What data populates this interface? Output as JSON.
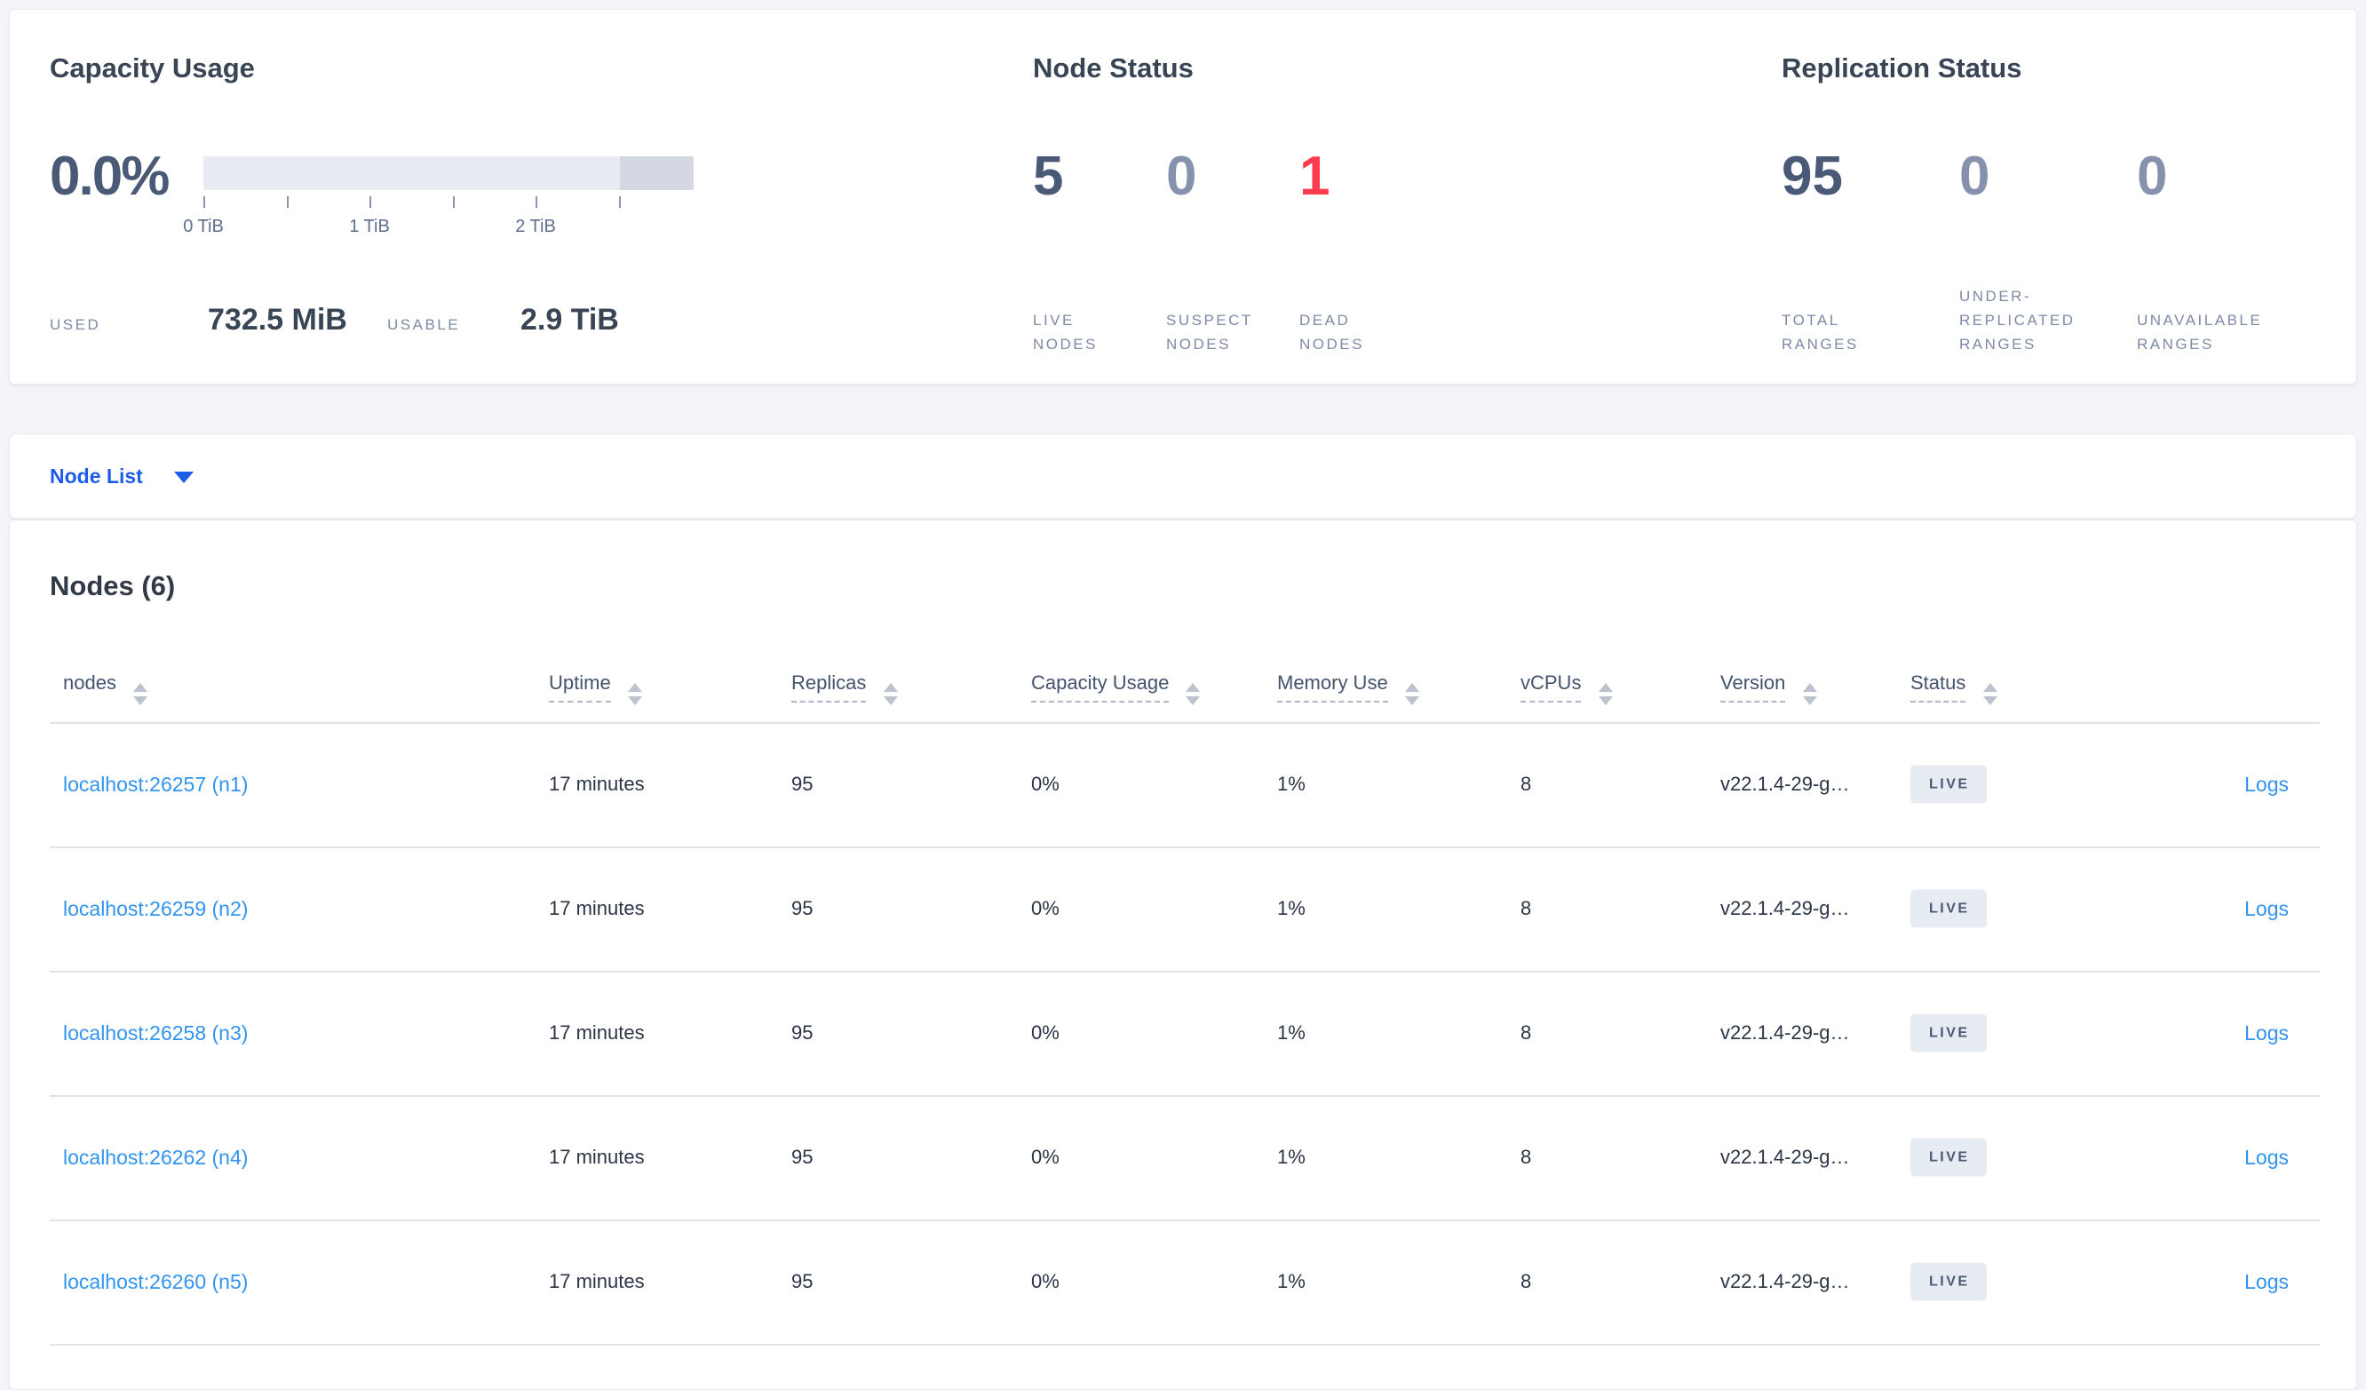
{
  "colors": {
    "page_bg": "#f4f5f9",
    "card_bg": "#ffffff",
    "card_border": "#e7eaf0",
    "title": "#394455",
    "number_dark": "#4a5a76",
    "number_muted": "#8591ad",
    "number_red": "#fc3b4e",
    "label_muted": "#7e8aa6",
    "link_blue": "#3194f0",
    "accent_blue": "#1c5ce8",
    "bar_track": "#e9ebf2",
    "bar_tail": "#d4d8e3",
    "separator": "#dfe2ec",
    "badge_bg": "#e7ecf3"
  },
  "summary": {
    "capacity": {
      "title": "Capacity Usage",
      "percent": "0.0%",
      "tick_labels": [
        "0 TiB",
        "1 TiB",
        "2 TiB"
      ],
      "used_label": "USED",
      "used_value": "732.5 MiB",
      "usable_label": "USABLE",
      "usable_value": "2.9 TiB"
    },
    "node_status": {
      "title": "Node Status",
      "stats": [
        {
          "value": "5",
          "lines": [
            "LIVE",
            "NODES"
          ]
        },
        {
          "value": "0",
          "lines": [
            "SUSPECT",
            "NODES"
          ]
        },
        {
          "value": "1",
          "lines": [
            "DEAD",
            "NODES"
          ]
        }
      ]
    },
    "replication": {
      "title": "Replication Status",
      "stats": [
        {
          "value": "95",
          "lines": [
            "TOTAL",
            "RANGES"
          ]
        },
        {
          "value": "0",
          "lines": [
            "UNDER-",
            "REPLICATED",
            "RANGES"
          ]
        },
        {
          "value": "0",
          "lines": [
            "UNAVAILABLE",
            "RANGES"
          ]
        }
      ]
    }
  },
  "nav": {
    "node_list_label": "Node List"
  },
  "table": {
    "title": "Nodes (6)",
    "columns": [
      {
        "label": "nodes"
      },
      {
        "label": "Uptime"
      },
      {
        "label": "Replicas"
      },
      {
        "label": "Capacity Usage"
      },
      {
        "label": "Memory Use"
      },
      {
        "label": "vCPUs"
      },
      {
        "label": "Version"
      },
      {
        "label": "Status"
      }
    ],
    "rows": [
      {
        "node": "localhost:26257 (n1)",
        "uptime": "17 minutes",
        "replicas": "95",
        "capacity": "0%",
        "memory": "1%",
        "vcpus": "8",
        "version": "v22.1.4-29-g…",
        "status": "LIVE",
        "logs": "Logs"
      },
      {
        "node": "localhost:26259 (n2)",
        "uptime": "17 minutes",
        "replicas": "95",
        "capacity": "0%",
        "memory": "1%",
        "vcpus": "8",
        "version": "v22.1.4-29-g…",
        "status": "LIVE",
        "logs": "Logs"
      },
      {
        "node": "localhost:26258 (n3)",
        "uptime": "17 minutes",
        "replicas": "95",
        "capacity": "0%",
        "memory": "1%",
        "vcpus": "8",
        "version": "v22.1.4-29-g…",
        "status": "LIVE",
        "logs": "Logs"
      },
      {
        "node": "localhost:26262 (n4)",
        "uptime": "17 minutes",
        "replicas": "95",
        "capacity": "0%",
        "memory": "1%",
        "vcpus": "8",
        "version": "v22.1.4-29-g…",
        "status": "LIVE",
        "logs": "Logs"
      },
      {
        "node": "localhost:26260 (n5)",
        "uptime": "17 minutes",
        "replicas": "95",
        "capacity": "0%",
        "memory": "1%",
        "vcpus": "8",
        "version": "v22.1.4-29-g…",
        "status": "LIVE",
        "logs": "Logs"
      }
    ]
  }
}
